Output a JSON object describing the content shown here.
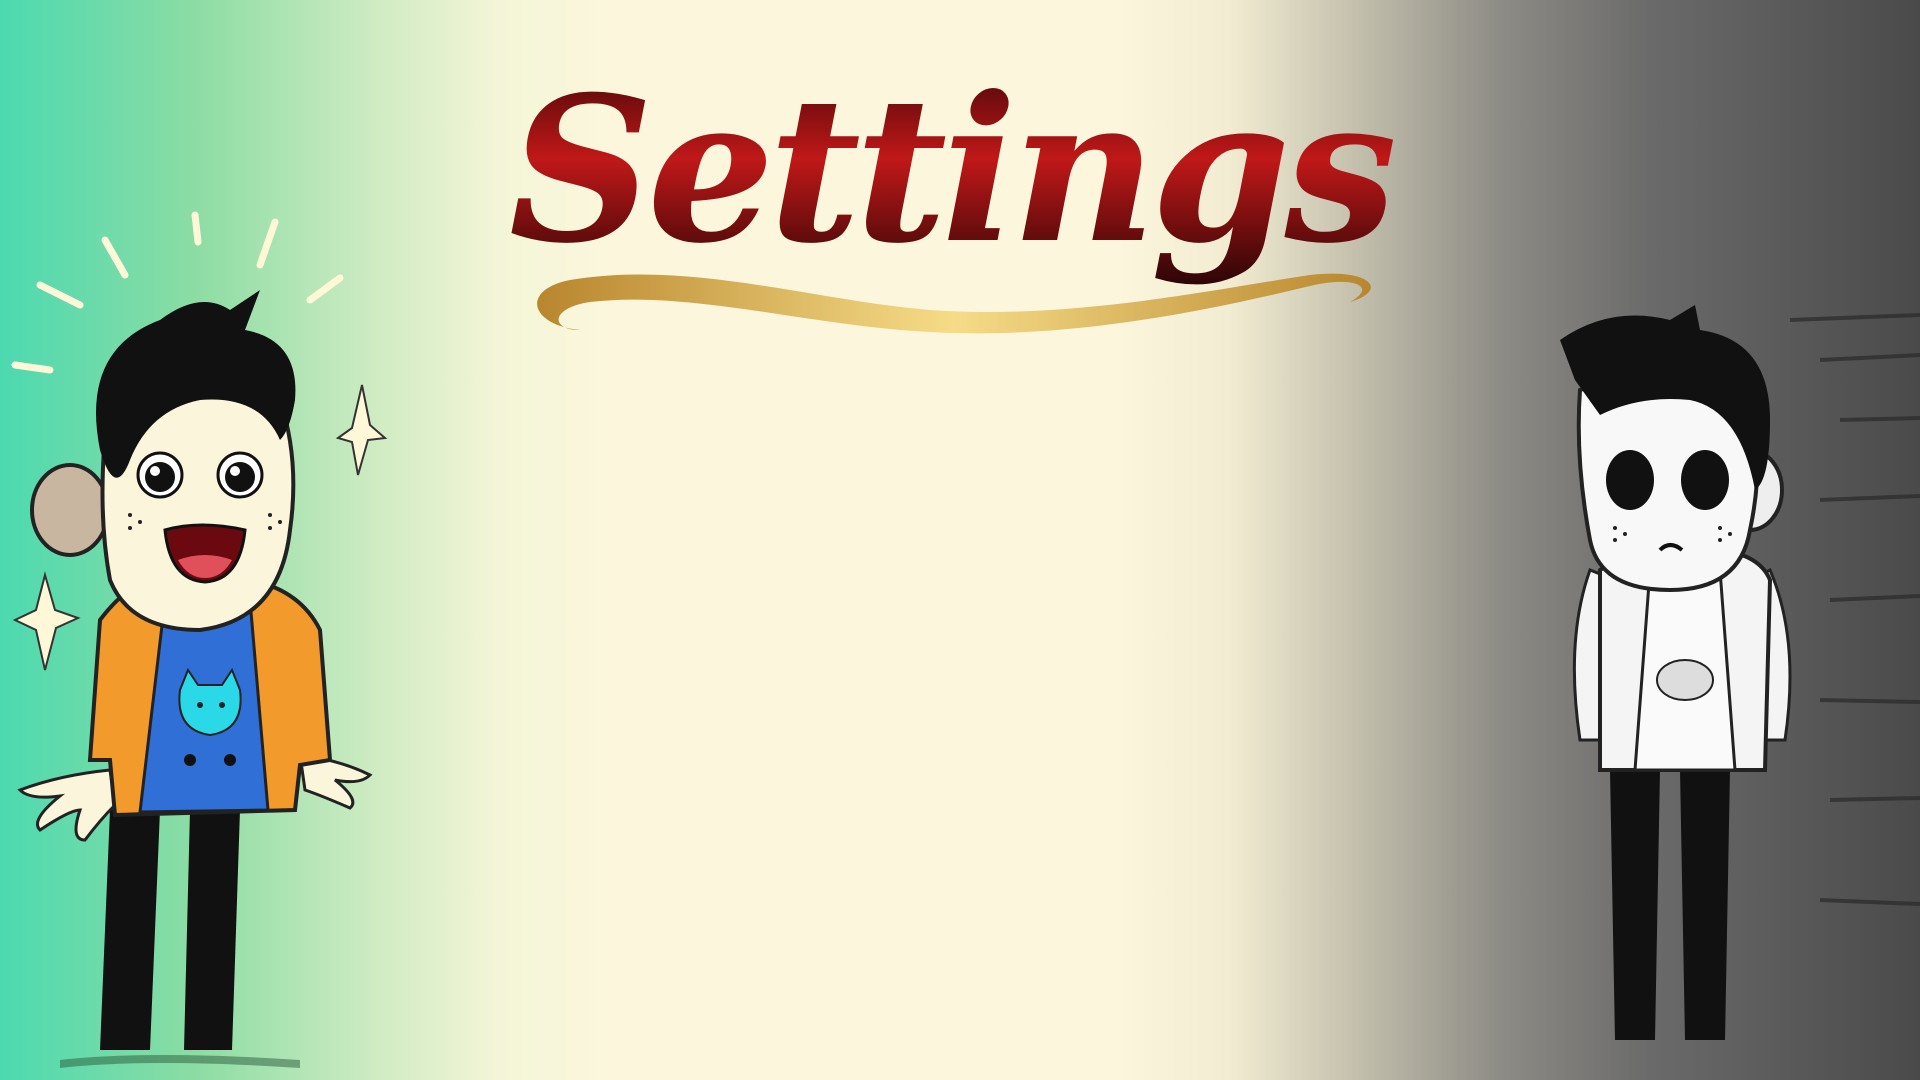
{
  "screen": {
    "title": "Settings"
  },
  "colors": {
    "title_red_light": "#c01818",
    "title_red_dark": "#3c0508",
    "swash_gold": "#d8b45a",
    "swash_gold_dark": "#b8862e",
    "background_left": "#4cd9b0",
    "background_center": "#fcf7dc",
    "background_right": "#4a4a4a"
  },
  "characters": {
    "happy": {
      "icon": "happy-character-illustration",
      "jacket_color": "#f39a2c",
      "shirt_color": "#2f6fd6",
      "cat_color": "#2bd8e8"
    },
    "sad": {
      "icon": "sad-character-illustration"
    }
  }
}
